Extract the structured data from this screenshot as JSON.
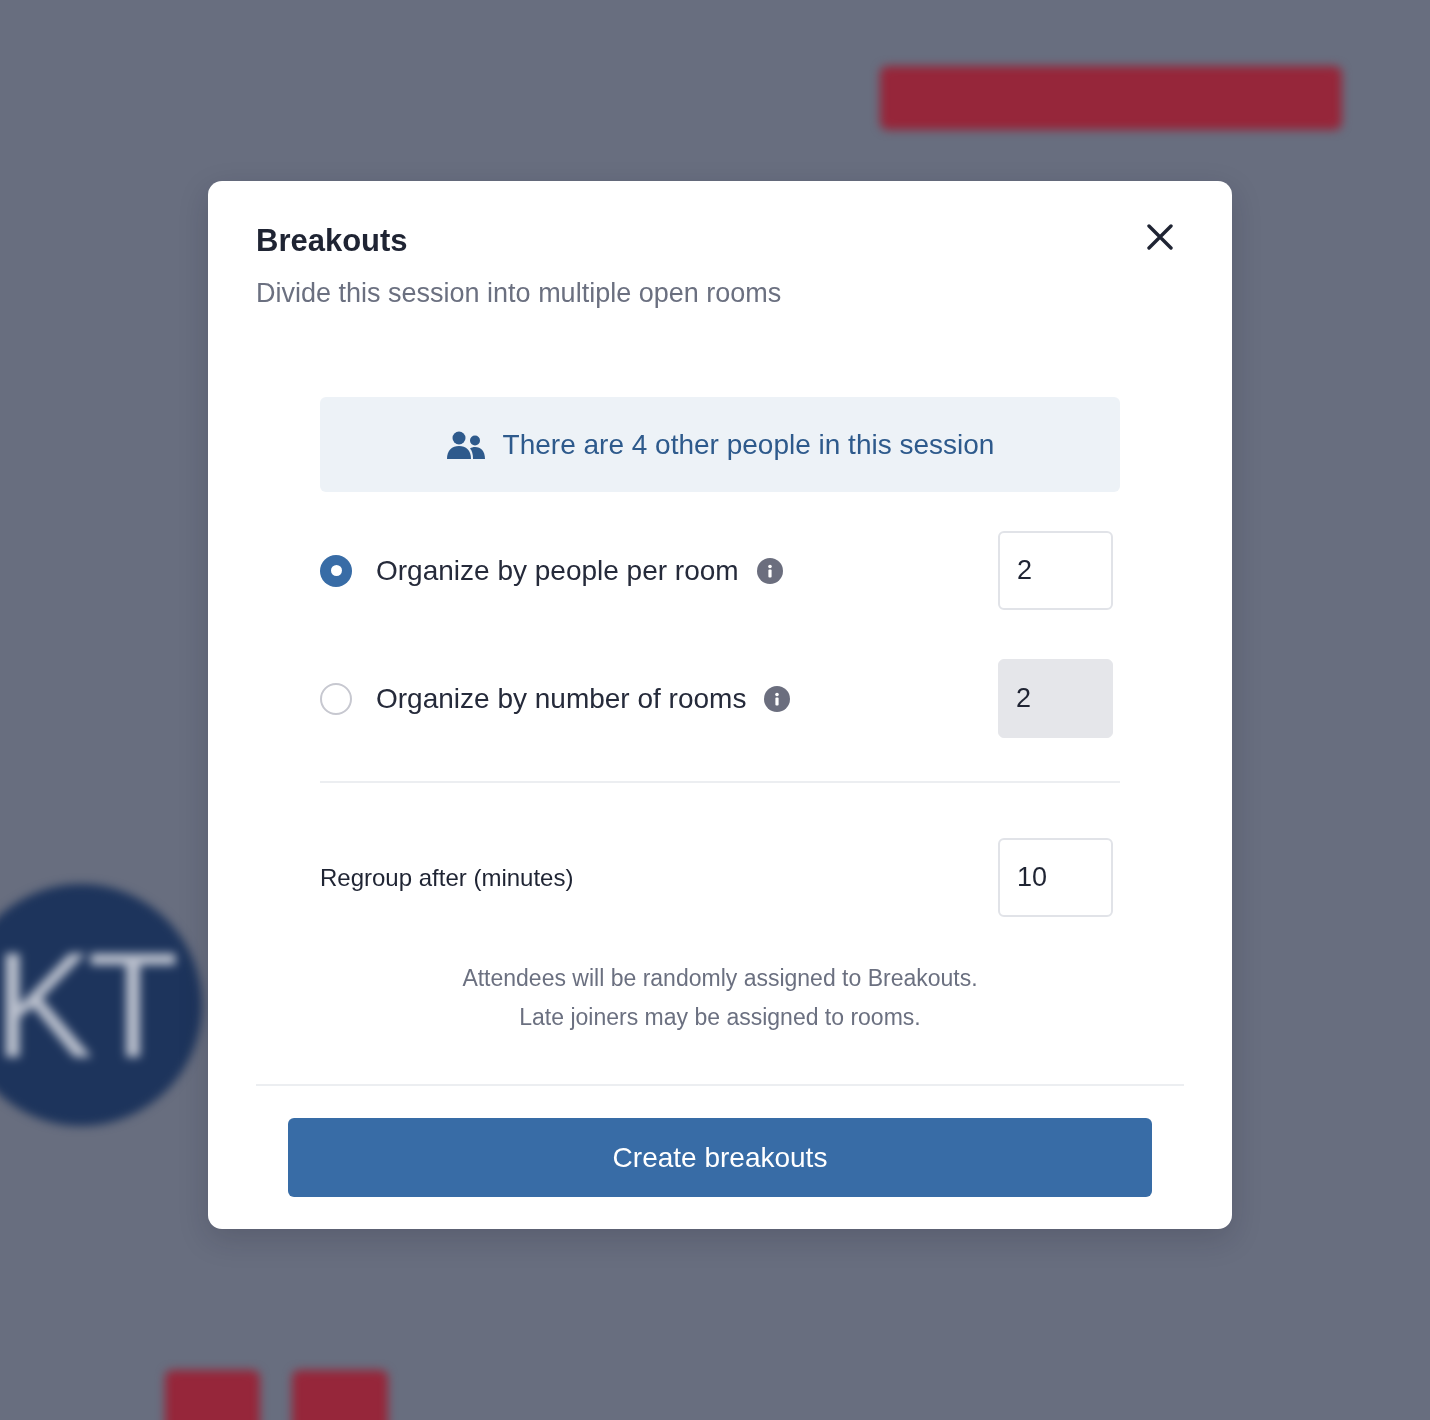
{
  "background": {
    "avatar_initials": "KT"
  },
  "dialog": {
    "title": "Breakouts",
    "subtitle": "Divide this session into multiple open rooms",
    "notice": "There are 4 other people in this session",
    "options": [
      {
        "label": "Organize by people per room",
        "selected": true,
        "value": "2"
      },
      {
        "label": "Organize by number of rooms",
        "selected": false,
        "value": "2"
      }
    ],
    "regroup": {
      "label": "Regroup after (minutes)",
      "value": "10"
    },
    "note_lines": [
      "Attendees will be randomly assigned to Breakouts.",
      "Late joiners may be assigned to rooms."
    ],
    "submit_button": "Create breakouts"
  }
}
